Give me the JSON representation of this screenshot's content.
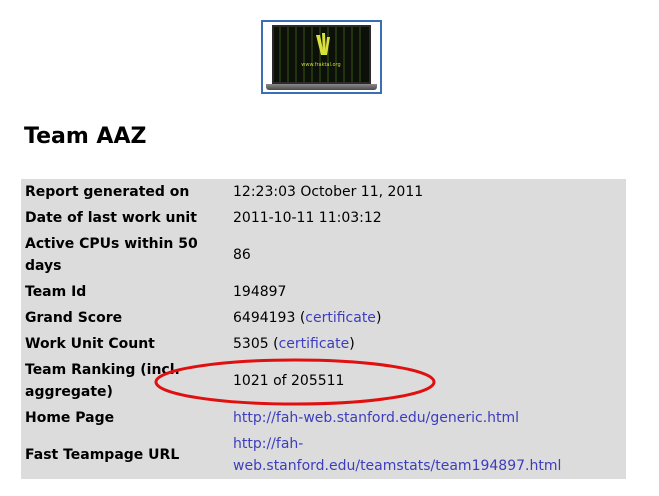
{
  "logo": {
    "caption": "www.fraktal.org"
  },
  "team": {
    "title": "Team AAZ"
  },
  "rows": [
    {
      "label": "Report generated on",
      "value": "12:23:03 October 11, 2011"
    },
    {
      "label": "Date of last work unit",
      "value": "2011-10-11 11:03:12"
    },
    {
      "label": "Active CPUs within 50 days",
      "value": "86"
    },
    {
      "label": "Team Id",
      "value": "194897"
    },
    {
      "label": "Grand Score",
      "value": "6494193",
      "link_open": "(",
      "link_text": "certificate",
      "link_close": ")"
    },
    {
      "label": "Work Unit Count",
      "value": "5305",
      "link_open": "(",
      "link_text": "certificate",
      "link_close": ")"
    },
    {
      "label": "Team Ranking (incl. aggregate)",
      "value": "1021 of 205511"
    },
    {
      "label": "Home Page",
      "link_text": "http://fah-web.stanford.edu/generic.html"
    },
    {
      "label": "Fast Teampage URL",
      "link_text_line1": "http://fah-",
      "link_text_line2": "web.stanford.edu/teamstats/team194897.html"
    }
  ],
  "colors": {
    "table_bg": "#dcdcdc",
    "link": "#3d3dbd",
    "highlight_ellipse": "#e01010",
    "logo_border": "#3a6fb5"
  }
}
